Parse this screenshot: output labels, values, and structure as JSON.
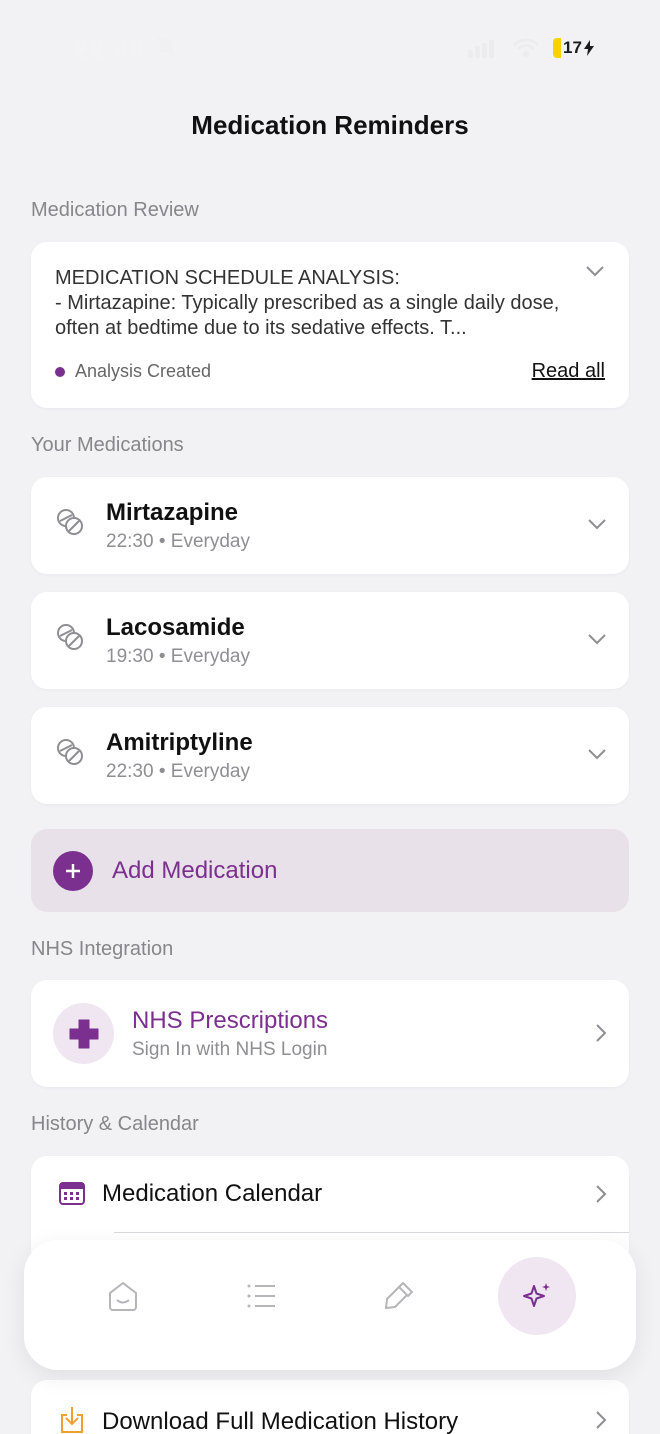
{
  "status_bar": {
    "time": "22:48",
    "battery": "17",
    "icons": [
      "bell-slash-icon",
      "signal-icon",
      "wifi-icon",
      "battery-charging-icon"
    ]
  },
  "header": {
    "title": "Medication Reminders"
  },
  "review": {
    "section_label": "Medication Review",
    "text": "MEDICATION SCHEDULE ANALYSIS:\n- Mirtazapine: Typically prescribed as a single daily dose, often at bedtime due to its sedative effects. T...",
    "status": "Analysis Created",
    "read_all": "Read all"
  },
  "medications": {
    "section_label": "Your Medications",
    "items": [
      {
        "name": "Mirtazapine",
        "time": "22:30",
        "frequency": "Everyday"
      },
      {
        "name": "Lacosamide",
        "time": "19:30",
        "frequency": "Everyday"
      },
      {
        "name": "Amitriptyline",
        "time": "22:30",
        "frequency": "Everyday"
      }
    ],
    "add_label": "Add Medication"
  },
  "nhs": {
    "section_label": "NHS Integration",
    "title": "NHS Prescriptions",
    "subtitle": "Sign In with NHS Login"
  },
  "history": {
    "section_label": "History & Calendar",
    "calendar_label": "Medication Calendar",
    "download_label": "Download Full Medication History"
  },
  "tab_bar": {
    "tabs": [
      "home-icon",
      "list-icon",
      "pipette-icon",
      "sparkles-icon"
    ],
    "active": "sparkles-icon"
  },
  "colors": {
    "accent": "#7b2f8e",
    "accent_light": "#efe6f2",
    "background": "#f2f2f5"
  }
}
